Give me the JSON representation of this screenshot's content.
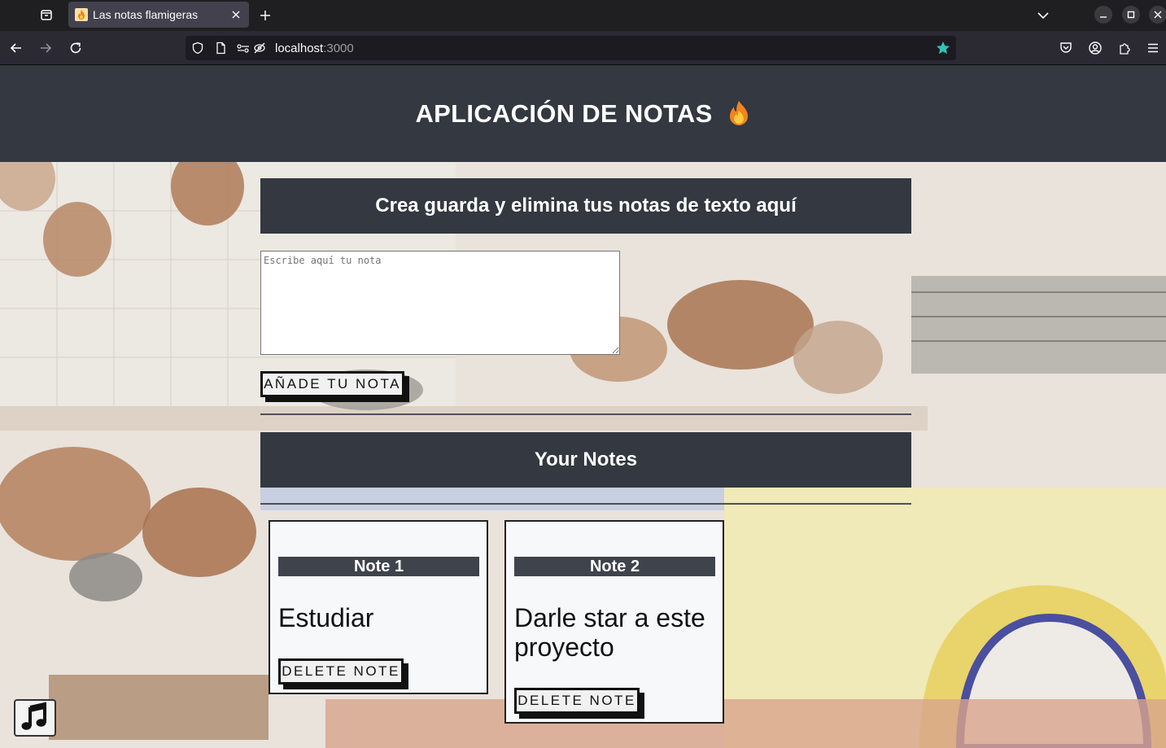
{
  "browser": {
    "tab": {
      "title": "Las notas flamigeras"
    },
    "url": {
      "host": "localhost",
      "port": ":3000"
    }
  },
  "app": {
    "title": "APLICACIÓN DE NOTAS",
    "create_heading": "Crea guarda y elimina tus notas de texto aquí",
    "input": {
      "placeholder": "Escribe aquí tu nota",
      "value": ""
    },
    "add_button": "AÑADE TU NOTA",
    "notes_heading": "Your Notes",
    "notes": [
      {
        "title": "Note 1",
        "text": "Estudiar",
        "delete_label": "DELETE NOTE"
      },
      {
        "title": "Note 2",
        "text": "Darle star a este proyecto",
        "delete_label": "DELETE NOTE"
      }
    ]
  },
  "icons": {
    "music": "music-note-icon",
    "flame": "fire-emoji-icon",
    "bookmark_star_color": "#2ec4b6"
  },
  "colors": {
    "header_bg": "#333841",
    "chrome_bg": "#2b2a33"
  }
}
